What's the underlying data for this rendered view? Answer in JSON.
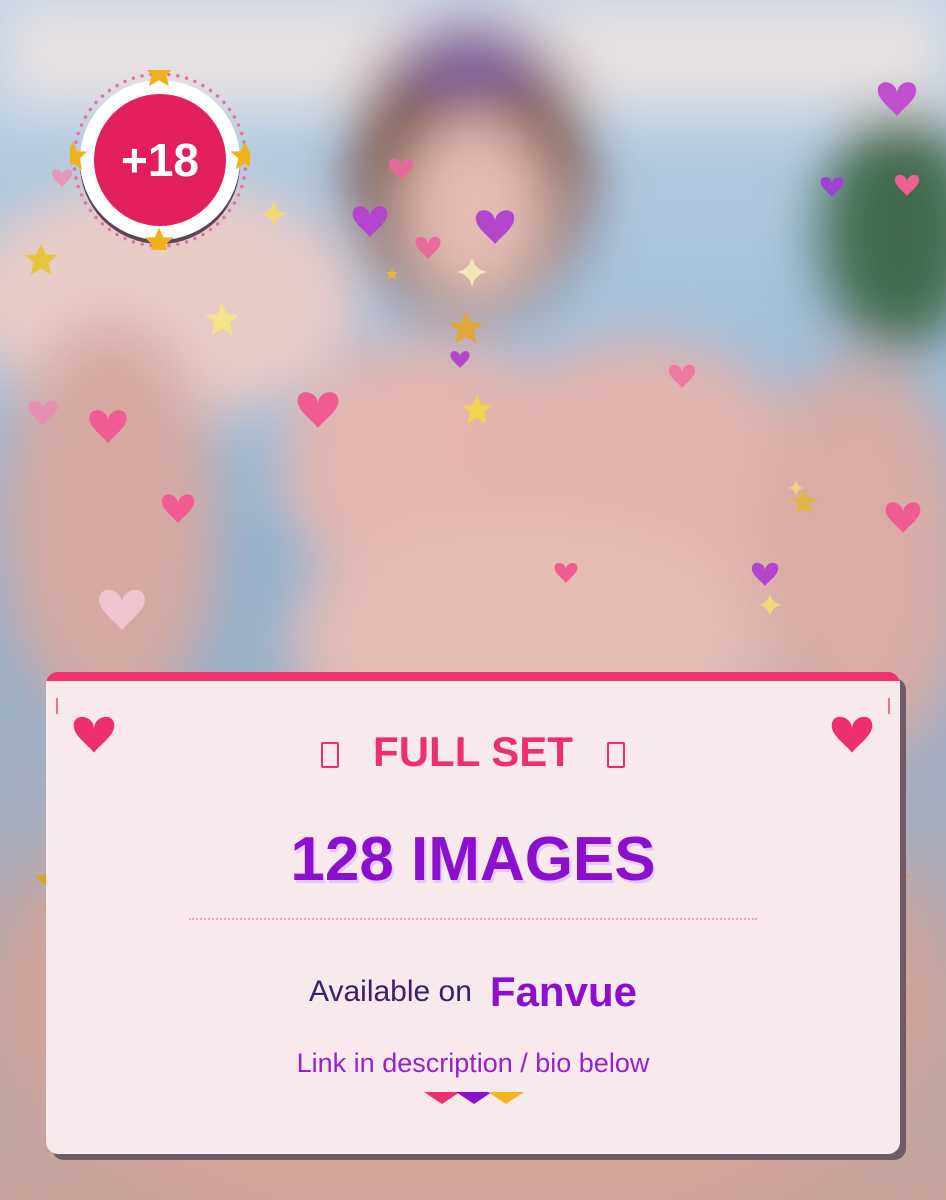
{
  "badge": {
    "label": "+18"
  },
  "card": {
    "title": "FULL SET",
    "count_text": "128 IMAGES",
    "available_label": "Available on",
    "platform": "Fanvue",
    "link_text": "Link in description / bio below"
  },
  "colors": {
    "pink": "#f0336f",
    "purple": "#8b0fcc",
    "gold": "#e0a21c",
    "card": "#f8e9ec"
  },
  "icons": [
    "heart-icon",
    "star-icon",
    "sparkle-icon"
  ]
}
